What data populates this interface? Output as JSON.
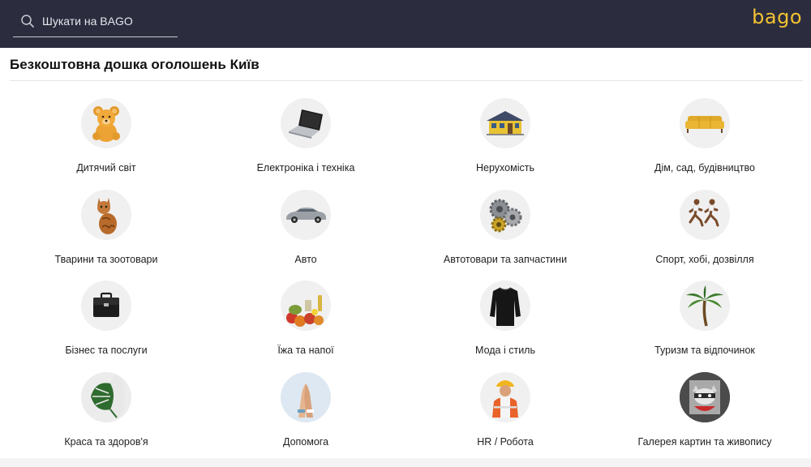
{
  "header": {
    "search_placeholder": "Шукати на BAGO",
    "logo": "bago",
    "colors": {
      "background": "#2b2c3e",
      "logo": "#f2c230"
    }
  },
  "main": {
    "title": "Безкоштовна дошка оголошень Київ"
  },
  "categories": [
    {
      "label": "Дитячий світ",
      "icon": "teddy-bear-icon"
    },
    {
      "label": "Електроніка і техніка",
      "icon": "laptop-icon"
    },
    {
      "label": "Нерухомість",
      "icon": "house-icon"
    },
    {
      "label": "Дім, сад, будівництво",
      "icon": "sofa-icon"
    },
    {
      "label": "Тварини та зоотовари",
      "icon": "cat-icon"
    },
    {
      "label": "Авто",
      "icon": "car-icon"
    },
    {
      "label": "Автотовари та запчастини",
      "icon": "gears-icon"
    },
    {
      "label": "Спорт, хобі, дозвілля",
      "icon": "runners-icon"
    },
    {
      "label": "Бізнес та послуги",
      "icon": "briefcase-icon"
    },
    {
      "label": "Їжа та напої",
      "icon": "food-icon"
    },
    {
      "label": "Мода і стиль",
      "icon": "sweater-icon"
    },
    {
      "label": "Туризм та відпочинок",
      "icon": "palm-tree-icon"
    },
    {
      "label": "Краса та здоров'я",
      "icon": "monstera-leaf-icon"
    },
    {
      "label": "Допомога",
      "icon": "helping-hands-icon"
    },
    {
      "label": "HR / Робота",
      "icon": "worker-icon"
    },
    {
      "label": "Галерея картин та живопису",
      "icon": "raccoon-painting-icon"
    }
  ]
}
